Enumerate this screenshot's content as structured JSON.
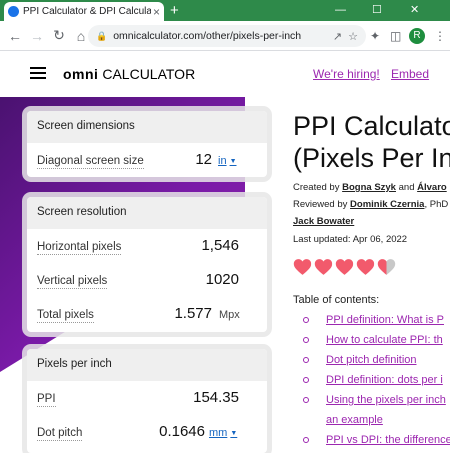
{
  "browser": {
    "tab_title": "PPI Calculator & DPI Calculator",
    "tab_close": "×",
    "new_tab": "+",
    "window_controls": {
      "minimize": "—",
      "maximize": "☐",
      "close": "✕"
    },
    "url": "omnicalculator.com/other/pixels-per-inch",
    "profile_initial": "R",
    "icons": [
      "back-icon",
      "forward-icon",
      "reload-icon",
      "home-icon",
      "lock-icon",
      "share-icon",
      "star-icon",
      "extensions-icon",
      "sidebar-icon",
      "menu-icon"
    ]
  },
  "site": {
    "logo_bold": "omni",
    "logo_rest": " CALCULATOR",
    "hiring_link": "We're hiring!",
    "embed_link": "Embed",
    "accent": "#9c27b0",
    "banner_color": "#7a1aa8"
  },
  "calculator": {
    "screen_dimensions": {
      "header": "Screen dimensions",
      "diagonal_label": "Diagonal screen size",
      "diagonal_value": "12",
      "diagonal_unit": "in"
    },
    "screen_resolution": {
      "header": "Screen resolution",
      "horizontal_label": "Horizontal pixels",
      "horizontal_value": "1,546",
      "vertical_label": "Vertical pixels",
      "vertical_value": "1020",
      "total_label": "Total pixels",
      "total_value": "1.577",
      "total_unit": "Mpx"
    },
    "pixels_per_inch": {
      "header": "Pixels per inch",
      "ppi_label": "PPI",
      "ppi_value": "154.35",
      "dot_pitch_label": "Dot pitch",
      "dot_pitch_value": "0.1646",
      "dot_pitch_unit": "mm"
    }
  },
  "article": {
    "title_line1": "PPI Calculato",
    "title_line2": "(Pixels Per In",
    "created_prefix": "Created by ",
    "author1": "Bogna Szyk",
    "and": " and ",
    "author2": "Álvaro",
    "reviewed_prefix": "Reviewed by ",
    "reviewer1": "Dominik Czernia",
    "reviewer1_suffix": ", PhD",
    "reviewer2": "Jack Bowater",
    "last_updated": "Last updated: Apr 06, 2022",
    "rating": 4.5,
    "toc_title": "Table of contents:",
    "toc": [
      "PPI definition: What is P",
      "How to calculate PPI: th",
      "Dot pitch definition",
      "DPI definition: dots per i",
      "Using the pixels per inch",
      "an example",
      "PPI vs DPI: the difference"
    ]
  }
}
